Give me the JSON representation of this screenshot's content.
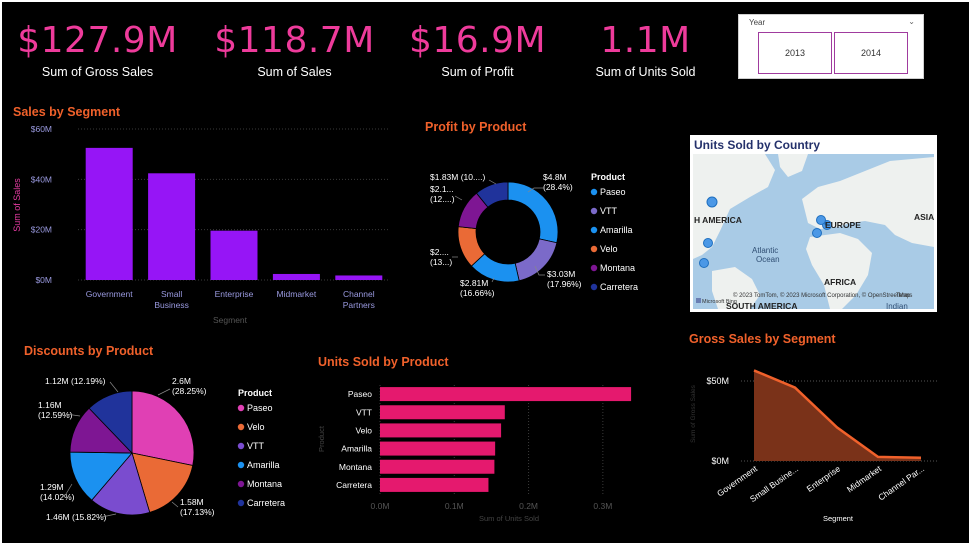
{
  "kpis": [
    {
      "value": "$127.9M",
      "label": "Sum of Gross Sales"
    },
    {
      "value": "$118.7M",
      "label": "Sum of  Sales"
    },
    {
      "value": "$16.9M",
      "label": "Sum of Profit"
    },
    {
      "value": "1.1M",
      "label": "Sum of Units Sold"
    }
  ],
  "slicer": {
    "title": "Year",
    "options": [
      "2013",
      "2014"
    ]
  },
  "map": {
    "title": "Units Sold by Country",
    "labels": {
      "na": "H AMERICA",
      "eu": "EUROPE",
      "as": "ASIA",
      "atl1": "Atlantic",
      "atl2": "Ocean",
      "af": "AFRICA",
      "sa": "SOUTH AMERICA",
      "ind": "Indian"
    },
    "attribution": "© 2023 TomTom, © 2023 Microsoft Corporation, © OpenStreetMap",
    "terms": "Terms",
    "bing": "Microsoft Bing"
  },
  "colors": {
    "accent_pink": "#ee3b9b",
    "title_orange": "#f0612b",
    "bar_purple": "#9615f6",
    "bar_pink": "#e5196e",
    "area_fill": "#7a3219",
    "area_line": "#f0612b",
    "product_colors": {
      "Paseo": "#1b91f0",
      "VTT": "#7b6ac9",
      "Amarilla": "#1b91f0",
      "Velo": "#ea6a36",
      "Montana": "#7e1693",
      "Carretera": "#20339b"
    },
    "discount_colors": {
      "Paseo": "#e040b4",
      "Velo": "#ea6a36",
      "VTT": "#7a4ccf",
      "Amarilla": "#1b91f0",
      "Montana": "#7e1693",
      "Carretera": "#20339b"
    }
  },
  "chart_data": [
    {
      "id": "sales_by_segment",
      "type": "bar",
      "title": "Sales by Segment",
      "xlabel": "Segment",
      "ylabel": "Sum of Sales",
      "categories": [
        "Government",
        "Small\nBusiness",
        "Enterprise",
        "Midmarket",
        "Channel\nPartners"
      ],
      "values": [
        52.5,
        42.4,
        19.6,
        2.4,
        1.8
      ],
      "ylim": [
        0,
        60
      ],
      "yticks": [
        "$0M",
        "$20M",
        "$40M",
        "$60M"
      ],
      "grid": true
    },
    {
      "id": "profit_by_product",
      "type": "pie",
      "title": "Profit by Product",
      "legend_title": "Product",
      "legend_position": "right",
      "categories": [
        "Paseo",
        "VTT",
        "Amarilla",
        "Velo",
        "Montana",
        "Carretera"
      ],
      "values": [
        4.8,
        3.03,
        2.81,
        2.3,
        2.1,
        1.83
      ],
      "data_labels": [
        [
          "$4.8M",
          "(28.4%)"
        ],
        [
          "$3.03M",
          "(17.96%)"
        ],
        [
          "$2.81M",
          "(16.66%)"
        ],
        [
          "$2....",
          "(13...)"
        ],
        [
          "$2.1...",
          "(12....)"
        ],
        [
          "$1.83M (10....)",
          ""
        ]
      ]
    },
    {
      "id": "discounts_by_product",
      "type": "pie",
      "title": "Discounts by Product",
      "legend_title": "Product",
      "legend_position": "right",
      "categories": [
        "Paseo",
        "Velo",
        "VTT",
        "Amarilla",
        "Montana",
        "Carretera"
      ],
      "values": [
        2.6,
        1.58,
        1.46,
        1.29,
        1.16,
        1.12
      ],
      "data_labels": [
        [
          "2.6M",
          "(28.25%)"
        ],
        [
          "1.58M",
          "(17.13%)"
        ],
        [
          "1.46M (15.82%)",
          ""
        ],
        [
          "1.29M",
          "(14.02%)"
        ],
        [
          "1.16M",
          "(12.59%)"
        ],
        [
          "1.12M (12.19%)",
          ""
        ]
      ]
    },
    {
      "id": "units_by_product",
      "type": "bar",
      "orientation": "horizontal",
      "title": "Units Sold by Product",
      "xlabel": "Sum of Units Sold",
      "ylabel": "Product",
      "categories": [
        "Paseo",
        "VTT",
        "Velo",
        "Amarilla",
        "Montana",
        "Carretera"
      ],
      "values": [
        0.338,
        0.168,
        0.163,
        0.155,
        0.154,
        0.146
      ],
      "xlim": [
        0,
        0.35
      ],
      "xticks": [
        "0.0M",
        "0.1M",
        "0.2M",
        "0.3M"
      ]
    },
    {
      "id": "gross_sales_by_segment",
      "type": "area",
      "title": "Gross Sales by Segment",
      "xlabel": "Segment",
      "ylabel": "Sum of Gross Sales",
      "categories": [
        "Government",
        "Small Busine...",
        "Enterprise",
        "Midmarket",
        "Channel Par..."
      ],
      "values": [
        56.6,
        45.9,
        21.0,
        2.6,
        2.0
      ],
      "ylim": [
        0,
        60
      ],
      "yticks": [
        "$0M",
        "$50M"
      ]
    }
  ]
}
